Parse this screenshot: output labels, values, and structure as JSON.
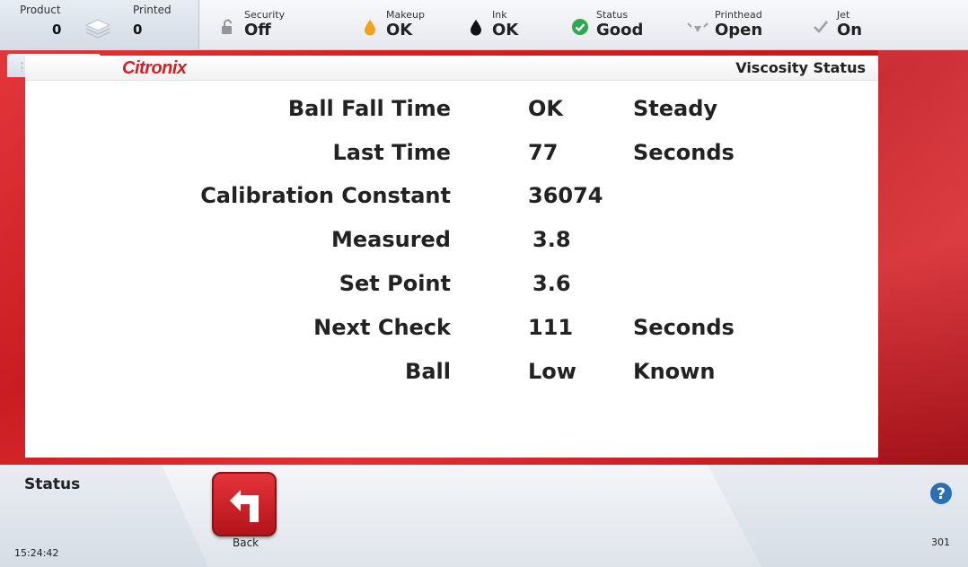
{
  "counters": {
    "product": {
      "label": "Product",
      "value": "0"
    },
    "printed": {
      "label": "Printed",
      "value": "0"
    }
  },
  "status_bar": [
    {
      "label": "Security",
      "value": "Off",
      "icon": "lock-open-icon"
    },
    {
      "label": "Makeup",
      "value": "OK",
      "icon": "makeup-drop-icon",
      "color": "#f0a21a"
    },
    {
      "label": "Ink",
      "value": "OK",
      "icon": "ink-drop-icon",
      "color": "#111111"
    },
    {
      "label": "Status",
      "value": "Good",
      "icon": "check-circle-icon",
      "color": "#2fa84f"
    },
    {
      "label": "Printhead",
      "value": "Open",
      "icon": "printhead-icon"
    },
    {
      "label": "Jet",
      "value": "On",
      "icon": "check-icon"
    }
  ],
  "logo": "Citronix",
  "page_title": "Viscosity Status",
  "rows": [
    {
      "label": "Ball Fall Time",
      "value": "OK",
      "unit": "Steady"
    },
    {
      "label": "Last Time",
      "value": "77",
      "unit": "Seconds"
    },
    {
      "label": "Calibration Constant",
      "value": "36074",
      "unit": ""
    },
    {
      "label": "Measured",
      "value": "3.8",
      "unit": ""
    },
    {
      "label": "Set Point",
      "value": "3.6",
      "unit": ""
    },
    {
      "label": "Next Check",
      "value": "111",
      "unit": "Seconds"
    },
    {
      "label": "Ball",
      "value": "Low",
      "unit": "Known"
    }
  ],
  "footer": {
    "status_label": "Status",
    "clock": "15:24:42",
    "back_label": "Back",
    "screen_number": "301"
  },
  "colors": {
    "brand_red": "#d51f26",
    "help_blue": "#2a6fb5"
  }
}
